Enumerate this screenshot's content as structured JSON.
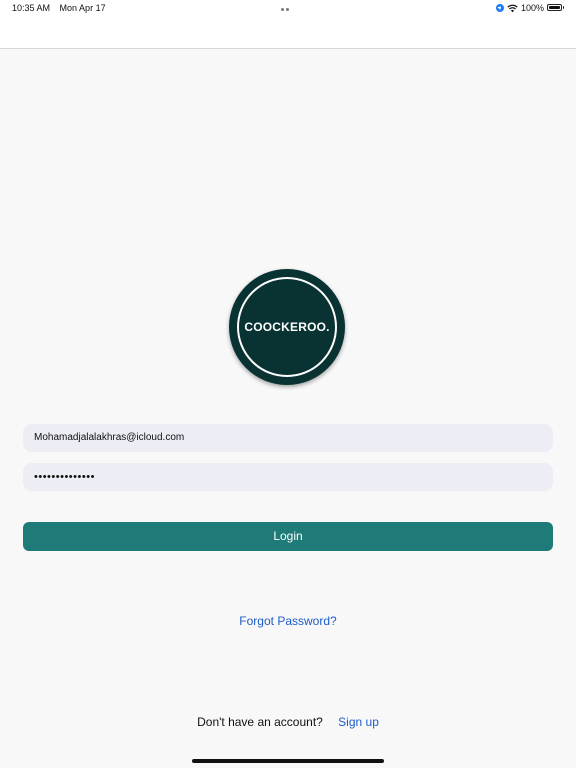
{
  "status_bar": {
    "time": "10:35 AM",
    "date": "Mon Apr 17",
    "battery_percent": "100%",
    "battery_level": 1.0,
    "icons": [
      "location-icon",
      "wifi-icon",
      "battery-icon"
    ]
  },
  "logo": {
    "text": "COOCKEROO.",
    "background_color": "#093333"
  },
  "login_form": {
    "email_value": "Mohamadjalalakhras@icloud.com",
    "password_value": "••••••••••••••",
    "login_label": "Login",
    "button_color": "#1e7b78"
  },
  "links": {
    "forgot_password": "Forgot Password?",
    "signup_prompt": "Don't have an account?",
    "signup_label": "Sign up",
    "link_color": "#1e5cc8"
  }
}
